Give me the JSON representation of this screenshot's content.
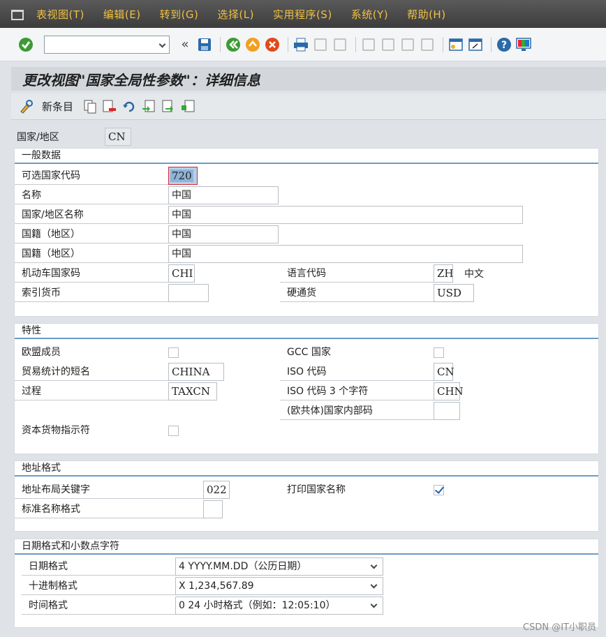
{
  "menu": [
    "表视图(T)",
    "编辑(E)",
    "转到(G)",
    "选择(L)",
    "实用程序(S)",
    "系统(Y)",
    "帮助(H)"
  ],
  "title": "更改视图\"国家全局性参数\"：详细信息",
  "apptoolbar": {
    "new_entries": "新条目"
  },
  "header": {
    "label": "国家/地区",
    "value": "CN"
  },
  "general": {
    "title": "一般数据",
    "alt_code_label": "可选国家代码",
    "alt_code": "720",
    "name_label": "名称",
    "name": "中国",
    "country_name_label": "国家/地区名称",
    "country_name": "中国",
    "nationality_label": "国籍（地区）",
    "nationality": "中国",
    "nationality2_label": "国籍（地区）",
    "nationality2": "中国",
    "vehicle_label": "机动车国家码",
    "vehicle": "CHI",
    "lang_label": "语言代码",
    "lang": "ZH",
    "lang_text": "中文",
    "index_cur_label": "索引货币",
    "index_cur": "",
    "hard_cur_label": "硬通货",
    "hard_cur": "USD"
  },
  "props": {
    "title": "特性",
    "eu_label": "欧盟成员",
    "gcc_label": "GCC 国家",
    "trade_label": "贸易统计的短名",
    "trade": "CHINA",
    "iso_label": "ISO 代码",
    "iso": "CN",
    "proc_label": "过程",
    "proc": "TAXCN",
    "iso3_label": "ISO 代码 3 个字符",
    "iso3": "CHN",
    "eu_code_label": "(欧共体)国家内部码",
    "eu_code": "",
    "capital_label": "资本货物指示符"
  },
  "address": {
    "title": "地址格式",
    "layout_label": "地址布局关键字",
    "layout": "022",
    "print_label": "打印国家名称",
    "print_checked": true,
    "std_label": "标准名称格式",
    "std": ""
  },
  "dates": {
    "title": "日期格式和小数点字符",
    "date_label": "日期格式",
    "date": "4 YYYY.MM.DD（公历日期）",
    "dec_label": "十进制格式",
    "dec": "X 1,234,567.89",
    "time_label": "时间格式",
    "time": "0 24 小时格式（例如：12:05:10）"
  },
  "watermark": "CSDN @IT小职员"
}
